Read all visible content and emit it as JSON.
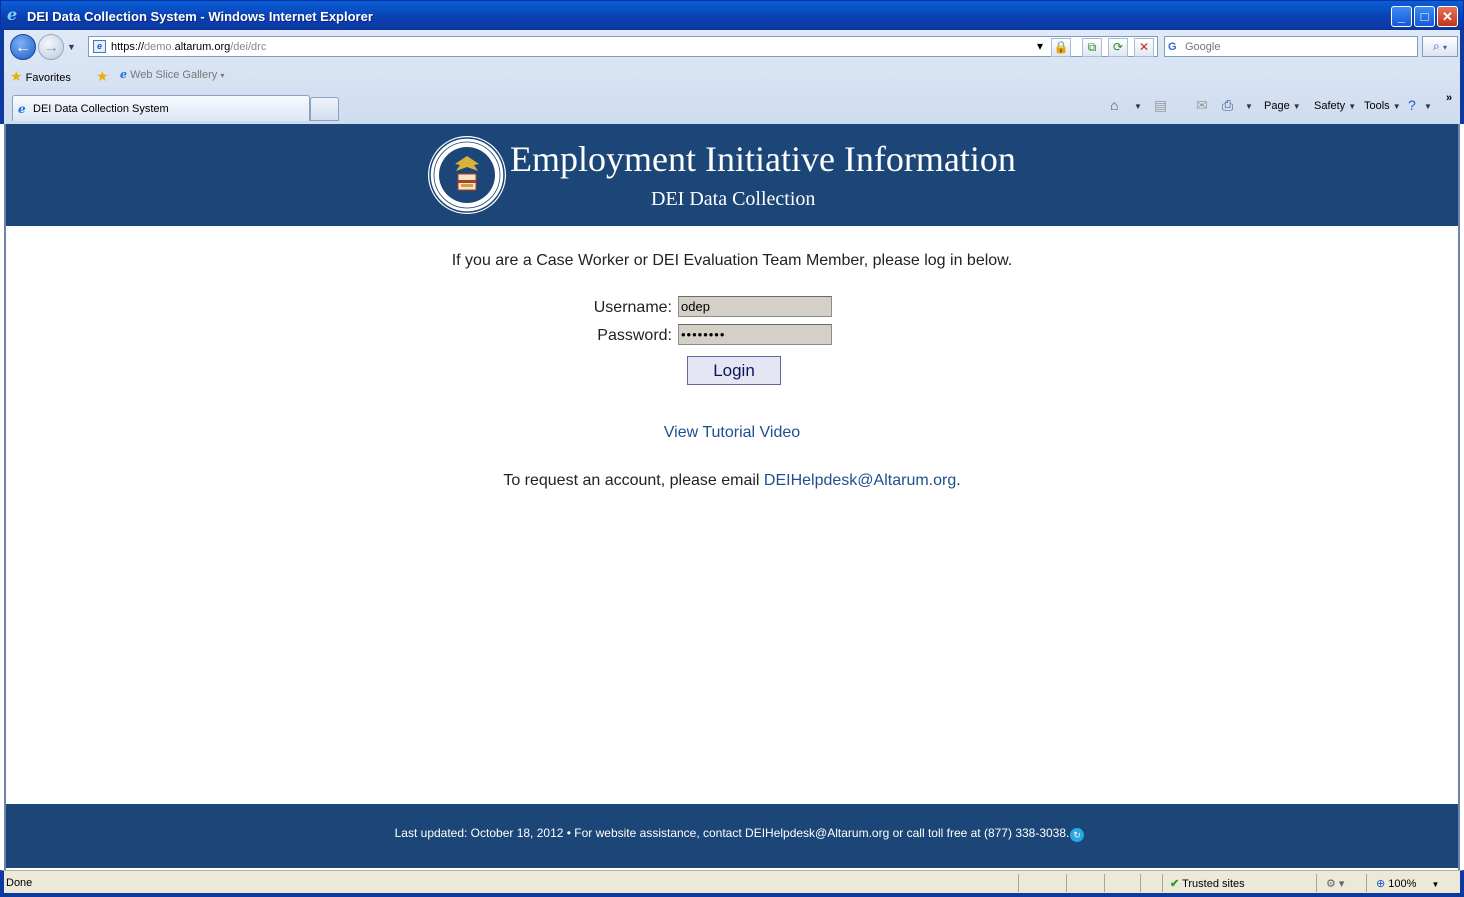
{
  "window": {
    "title": "DEI Data Collection System - Windows Internet Explorer",
    "minimize": "_",
    "maximize": "□",
    "close": "✕"
  },
  "address": {
    "url_prefix": "https://",
    "url_sub": "demo.",
    "url_host": "altarum.org",
    "url_path": "/dei/drc"
  },
  "search": {
    "placeholder": "Google"
  },
  "favorites": {
    "favorites_label": "Favorites",
    "web_slice_label": "Web Slice Gallery"
  },
  "tabs": [
    {
      "label": "DEI Data Collection System"
    }
  ],
  "command_bar": {
    "page": "Page",
    "safety": "Safety",
    "tools": "Tools"
  },
  "header": {
    "title": "Employment Initiative Information",
    "subtitle": "DEI Data Collection"
  },
  "login": {
    "intro": "If you are a Case Worker or DEI Evaluation Team Member, please log in below.",
    "username_label": "Username:",
    "username_value": "odep",
    "password_label": "Password:",
    "password_value": "••••••••",
    "login_button": "Login",
    "tutorial_link": "View Tutorial Video",
    "request_text": "To request an account, please email",
    "request_email": "DEIHelpdesk@Altarum.org",
    "request_period": "."
  },
  "footer": {
    "text": "Last updated: October 18, 2012 • For website assistance, contact DEIHelpdesk@Altarum.org or call toll free at (877) 338-3038."
  },
  "status": {
    "done": "Done",
    "zone": "Trusted sites",
    "zoom": "100%"
  },
  "colors": {
    "banner": "#1b4677",
    "link": "#1f4f8f",
    "titlebar": "#0a4fc8"
  }
}
